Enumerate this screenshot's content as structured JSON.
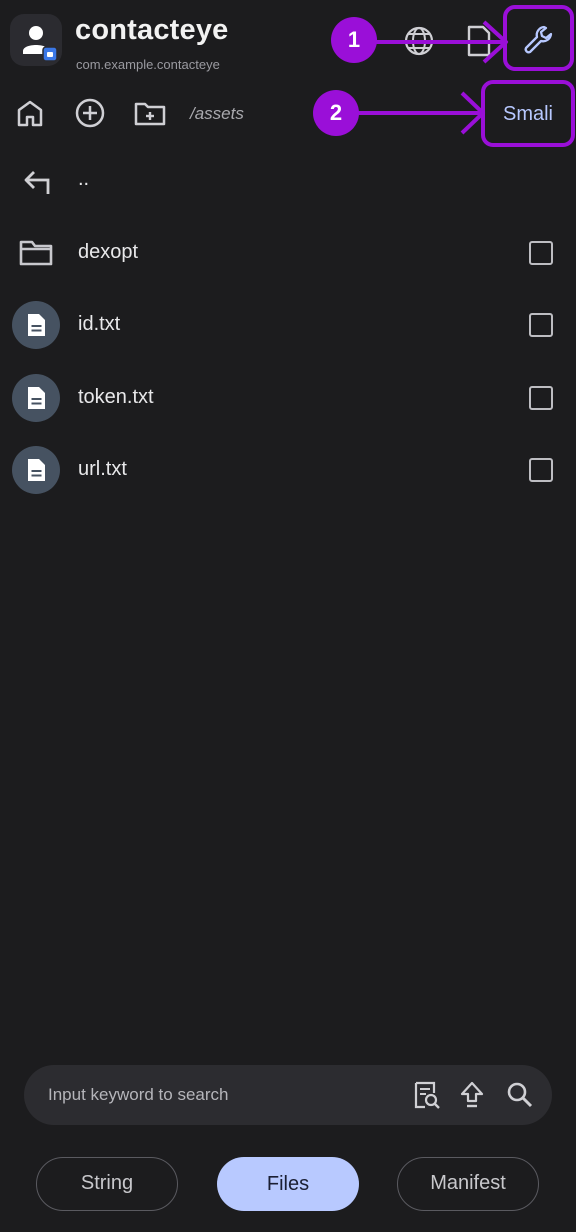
{
  "header": {
    "app_name": "contacteye",
    "package": "com.example.contacteye",
    "icons": {
      "app": "person-app-icon",
      "web": "globe-icon",
      "export": "file-export-icon",
      "tools": "wrench-icon"
    }
  },
  "toolbar": {
    "path": "/assets",
    "smali_label": "Smali",
    "icons": [
      "home-icon",
      "add-circle-icon",
      "new-folder-icon"
    ]
  },
  "annotations": {
    "badge1": "1",
    "badge2": "2",
    "color": "#9a0fd8"
  },
  "file_list": {
    "parent": "..",
    "items": [
      {
        "name": "dexopt",
        "type": "folder",
        "checked": false
      },
      {
        "name": "id.txt",
        "type": "file",
        "checked": false
      },
      {
        "name": "token.txt",
        "type": "file",
        "checked": false
      },
      {
        "name": "url.txt",
        "type": "file",
        "checked": false
      }
    ]
  },
  "search": {
    "placeholder": "Input keyword to search"
  },
  "tabs": {
    "string": "String",
    "files": "Files",
    "manifest": "Manifest",
    "active": "Files"
  },
  "colors": {
    "background": "#1c1c1e",
    "accent": "#b8c9ff",
    "highlight": "#9a0fd8"
  }
}
